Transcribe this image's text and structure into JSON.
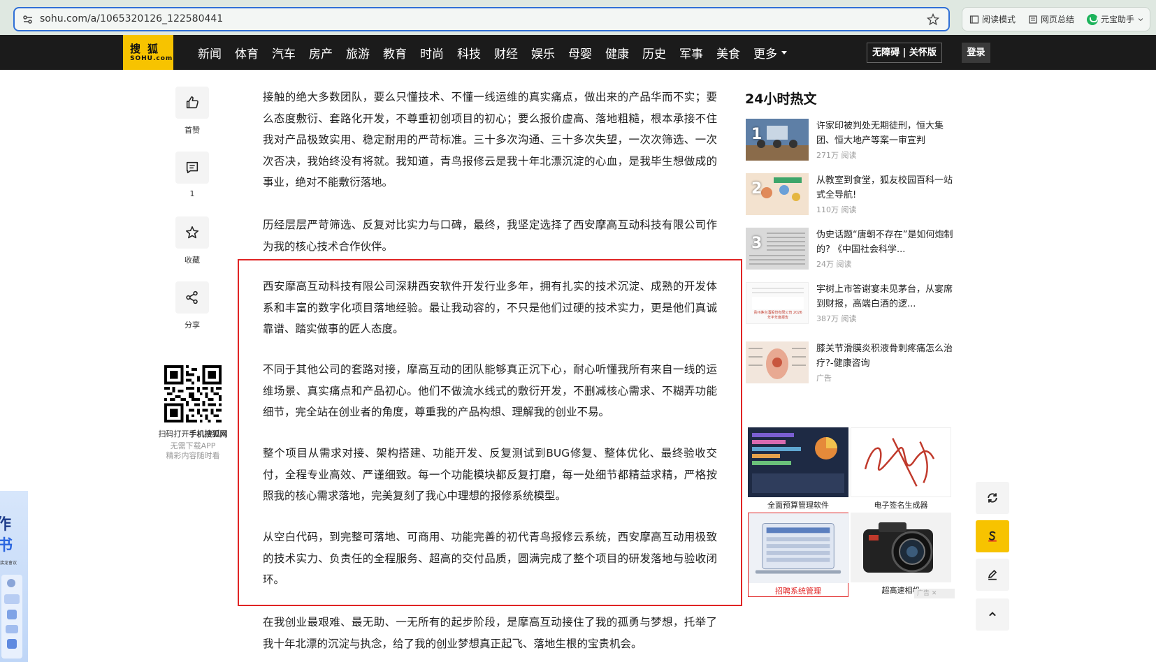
{
  "browser": {
    "url": "sohu.com/a/1065320126_122580441",
    "reading_mode": "阅读模式",
    "page_summary": "网页总结",
    "assistant": "元宝助手"
  },
  "nav": {
    "logo_top": "搜狐",
    "logo_bottom": "SOHU.com",
    "items": [
      "新闻",
      "体育",
      "汽车",
      "房产",
      "旅游",
      "教育",
      "时尚",
      "科技",
      "财经",
      "娱乐",
      "母婴",
      "健康",
      "历史",
      "军事",
      "美食"
    ],
    "more": "更多",
    "accessibility": "无障碍 | 关怀版",
    "login": "登录"
  },
  "actions": {
    "like": "首赞",
    "comment_count": "1",
    "favorite": "收藏",
    "share": "分享"
  },
  "qr": {
    "line1_prefix": "扫码打开",
    "line1_bold": "手机搜狐网",
    "line2": "无需下载APP",
    "line3": "精彩内容随时看"
  },
  "side_ad": {
    "char1": "作",
    "char2": "书",
    "small": "接龙會议"
  },
  "article": {
    "paragraphs": [
      "接触的绝大多数团队，要么只懂技术、不懂一线运维的真实痛点，做出来的产品华而不实；要么态度敷衍、套路化开发，不尊重初创项目的初心；要么报价虚高、落地粗糙，根本承接不住我对产品极致实用、稳定耐用的严苛标准。三十多次沟通、三十多次失望，一次次筛选、一次次否决，我始终没有将就。我知道，青鸟报修云是我十年北漂沉淀的心血，是我毕生想做成的事业，绝对不能敷衍落地。",
      "历经层层严苛筛选、反复对比实力与口碑，最终，我坚定选择了西安摩高互动科技有限公司作为我的核心技术合作伙伴。",
      "西安摩高互动科技有限公司深耕西安软件开发行业多年，拥有扎实的技术沉淀、成熟的开发体系和丰富的数字化项目落地经验。最让我动容的，不只是他们过硬的技术实力，更是他们真诚靠谱、踏实做事的匠人态度。",
      "不同于其他公司的套路对接，摩高互动的团队能够真正沉下心，耐心听懂我所有来自一线的运维场景、真实痛点和产品初心。他们不做流水线式的敷衍开发，不删减核心需求、不糊弄功能细节，完全站在创业者的角度，尊重我的产品构想、理解我的创业不易。",
      "整个项目从需求对接、架构搭建、功能开发、反复测试到BUG修复、整体优化、最终验收交付，全程专业高效、严谨细致。每一个功能模块都反复打磨，每一处细节都精益求精，严格按照我的核心需求落地，完美复刻了我心中理想的报修系统模型。",
      "从空白代码，到完整可落地、可商用、功能完善的初代青鸟报修云系统，西安摩高互动用极致的技术实力、负责任的全程服务、超高的交付品质，圆满完成了整个项目的研发落地与验收闭环。",
      "在我创业最艰难、最无助、一无所有的起步阶段，是摩高互动接住了我的孤勇与梦想，托举了我十年北漂的沉淀与执念，给了我的创业梦想真正起飞、落地生根的宝贵机会。"
    ]
  },
  "hot": {
    "title": "24小时热文",
    "items": [
      {
        "num": "1",
        "title": "许家印被判处无期徒刑，恒大集团、恒大地产等案一审宣判",
        "meta": "271万 阅读"
      },
      {
        "num": "2",
        "title": "从教室到食堂，狐友校园百科一站式全导航!",
        "meta": "110万 阅读"
      },
      {
        "num": "3",
        "title": "伪史话题“唐朝不存在”是如何炮制的? 《中国社会科学...",
        "meta": "24万 阅读"
      },
      {
        "num": "",
        "title": "宇树上市答谢宴未见茅台，从宴席到财报，高端白酒的逻...",
        "meta": "387万 阅读"
      },
      {
        "num": "",
        "title": "膝关节滑膜炎积液骨刺疼痛怎么治疗?-健康咨询",
        "meta": "广告"
      }
    ],
    "thumb4_text": "贵州茅台酒股份有限公司 2026年半年度报告"
  },
  "ads": {
    "items": [
      "全面预算管理软件",
      "电子签名生成器",
      "招聘系统管理",
      "超高速相机"
    ],
    "mark": "广告"
  },
  "colors": {
    "accent": "#f7c300",
    "nav_bg": "#1b1b1b",
    "highlight": "#e02424",
    "url_border": "#2f6fd6"
  }
}
